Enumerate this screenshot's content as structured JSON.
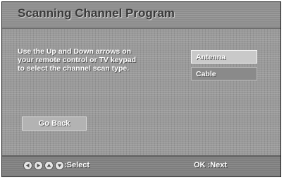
{
  "header": {
    "title": "Scanning Channel Program"
  },
  "instruction": {
    "lines": [
      "Use the Up and Down arrows on",
      "your remote control or TV keypad",
      "to select the channel scan type."
    ]
  },
  "scan_options": [
    {
      "label": "Antenna",
      "selected": true
    },
    {
      "label": "Cable",
      "selected": false
    }
  ],
  "go_back": {
    "label": "Go Back"
  },
  "footer": {
    "nav_icons": [
      "left-arrow-icon",
      "right-arrow-icon",
      "up-arrow-icon",
      "down-arrow-icon"
    ],
    "select_label": ":Select",
    "ok_label": "OK :Next"
  }
}
